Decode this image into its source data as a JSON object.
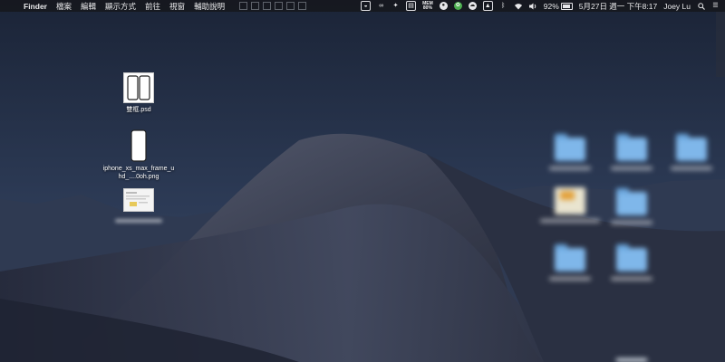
{
  "menubar": {
    "apple_symbol": "",
    "app_name": "Finder",
    "menus": [
      "檔案",
      "編輯",
      "顯示方式",
      "前往",
      "視窗",
      "輔助說明"
    ],
    "status": {
      "memory_label_top": "MEM",
      "memory_label_bottom": "80%",
      "battery_percent": "92%",
      "battery_level": 0.92,
      "datetime": "5月27日 週一 下午8:17",
      "user": "Joey Lu"
    },
    "icons": [
      "bear-icon",
      "creative-cloud-icon",
      "dropbox-icon",
      "disk-icon",
      "memory-meter-icon",
      "eye-icon",
      "green-app-icon",
      "cloud-icon",
      "airplay-icon",
      "bluetooth-icon",
      "wifi-icon",
      "volume-icon",
      "battery-icon",
      "search-icon",
      "control-center-icon"
    ]
  },
  "desktop": {
    "files": [
      {
        "name": "雙框.psd"
      },
      {
        "name": "iphone_xs_max_frame_uhd_....0oh.png"
      },
      {
        "name": ""
      }
    ]
  },
  "colors": {
    "menubar_bg": "#16181e",
    "folder": "#7fb7ea",
    "sky_top": "#1a2438",
    "dune": "#3b4052"
  }
}
